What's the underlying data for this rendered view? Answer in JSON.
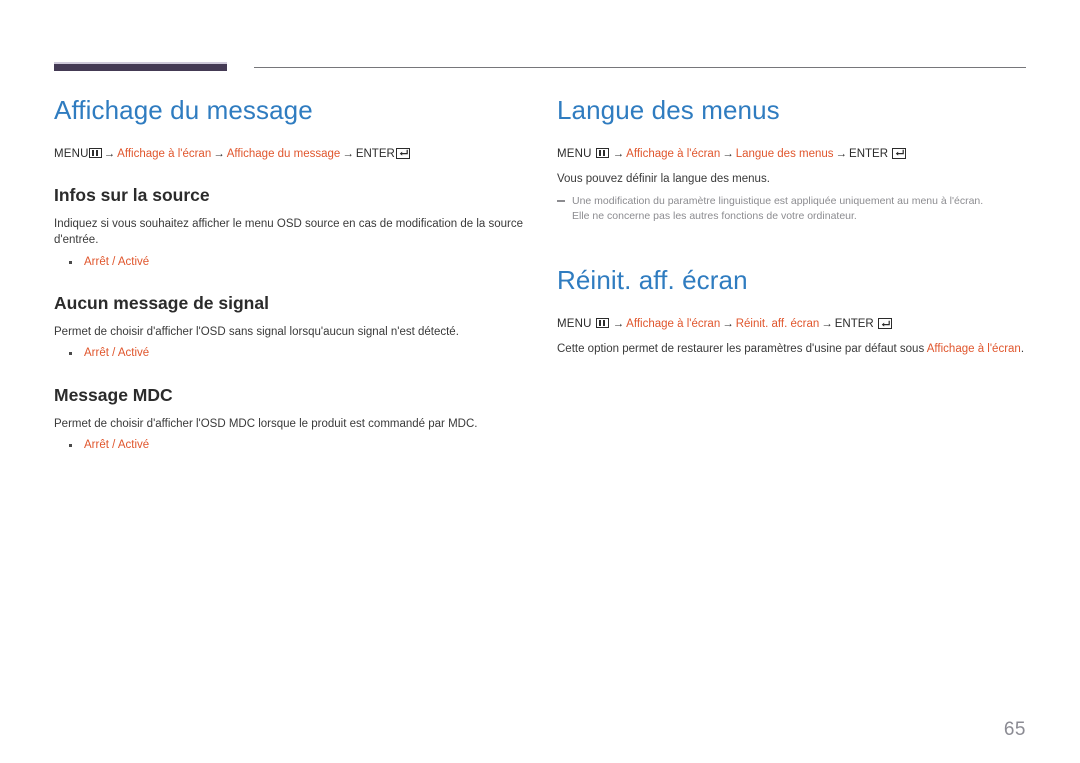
{
  "document": {
    "page_number": "65",
    "accent_blue": "#2f7cc0",
    "accent_orange": "#e0562d",
    "header_block_color": "#443a54",
    "note_gray": "#8c8c90"
  },
  "icons": {
    "menu": "menu-grid-icon",
    "enter": "enter-return-icon",
    "arrow": "→"
  },
  "left_column": {
    "title": "Affichage du message",
    "path": {
      "menu_label": "MENU",
      "arrow": "→",
      "crumb1": "Affichage à l'écran",
      "crumb2": "Affichage du message",
      "enter_label": "ENTER"
    },
    "sections": [
      {
        "heading": "Infos sur la source",
        "body": "Indiquez si vous souhaitez afficher le menu OSD source en cas de modification de la source d'entrée.",
        "options": "Arrêt / Activé"
      },
      {
        "heading": "Aucun message de signal",
        "body": "Permet de choisir d'afficher l'OSD sans signal lorsqu'aucun signal n'est détecté.",
        "options": "Arrêt / Activé"
      },
      {
        "heading": "Message MDC",
        "body": "Permet de choisir d'afficher l'OSD MDC lorsque le produit est commandé par MDC.",
        "options": "Arrêt / Activé"
      }
    ]
  },
  "right_column": {
    "section1": {
      "title": "Langue des menus",
      "path": {
        "menu_label": "MENU",
        "arrow": "→",
        "crumb1": "Affichage à l'écran",
        "crumb2": "Langue des menus",
        "enter_label": "ENTER"
      },
      "body": "Vous pouvez définir la langue des menus.",
      "note_line1": "Une modification du paramètre linguistique est appliquée uniquement au menu à l'écran.",
      "note_line2": "Elle ne concerne pas les autres fonctions de votre ordinateur."
    },
    "section2": {
      "title": "Réinit. aff. écran",
      "path": {
        "menu_label": "MENU",
        "arrow": "→",
        "crumb1": "Affichage à l'écran",
        "crumb2": "Réinit. aff. écran",
        "enter_label": "ENTER"
      },
      "body_part1": "Cette option permet de restaurer les paramètres d'usine par défaut sous ",
      "body_highlight": "Affichage à l'écran",
      "body_part2": "."
    }
  }
}
